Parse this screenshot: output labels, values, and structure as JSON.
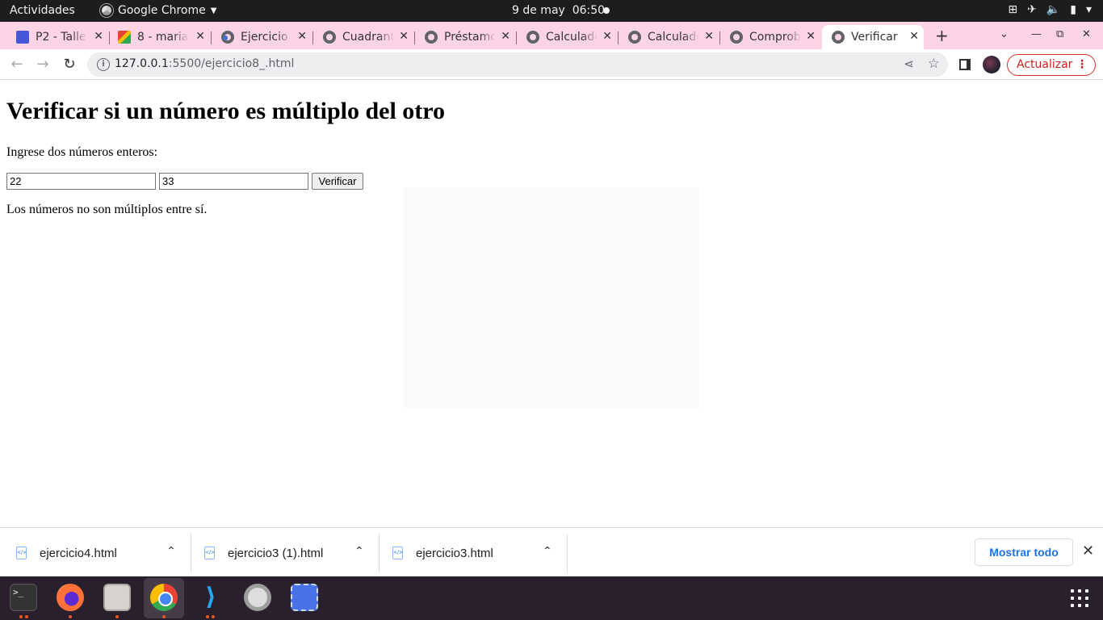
{
  "topbar": {
    "activities": "Actividades",
    "app_name": "Google Chrome",
    "clock_date": "9 de may",
    "clock_time": "06:50"
  },
  "tabs": [
    {
      "title": "P2 - Taller",
      "icon": "contact-icon"
    },
    {
      "title": "8 - mariac",
      "icon": "gmail-icon"
    },
    {
      "title": "Ejercicio",
      "icon": "globe-icon"
    },
    {
      "title": "Cuadrant",
      "icon": "globe-icon"
    },
    {
      "title": "Préstamo",
      "icon": "globe-icon"
    },
    {
      "title": "Calculado",
      "icon": "globe-icon"
    },
    {
      "title": "Calculado",
      "icon": "globe-icon"
    },
    {
      "title": "Comprob",
      "icon": "globe-icon"
    },
    {
      "title": "Verificar",
      "icon": "globe-icon",
      "active": true
    }
  ],
  "address_bar": {
    "host": "127.0.0.1",
    "path": ":5500/ejercicio8_.html"
  },
  "update_button": "Actualizar",
  "page": {
    "heading": "Verificar si un número es múltiplo del otro",
    "prompt": "Ingrese dos números enteros:",
    "input1_value": "22",
    "input2_value": "33",
    "button_label": "Verificar",
    "result": "Los números no son múltiplos entre sí."
  },
  "downloads": [
    {
      "name": "ejercicio4.html"
    },
    {
      "name": "ejercicio3 (1).html"
    },
    {
      "name": "ejercicio3.html"
    }
  ],
  "show_all": "Mostrar todo",
  "dock": [
    "terminal",
    "firefox",
    "files",
    "chrome",
    "vscode",
    "settings",
    "screenshot"
  ]
}
